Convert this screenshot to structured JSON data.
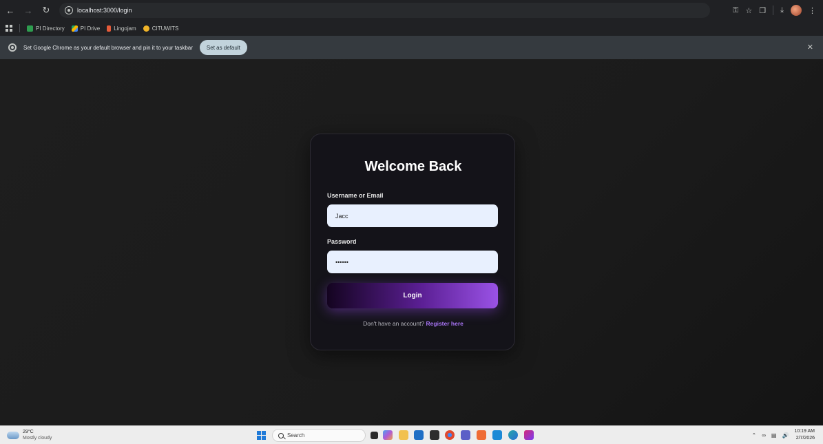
{
  "browser": {
    "url": "localhost:3000/login",
    "bookmarks": [
      {
        "label": "PI Directory",
        "color": "#2e9d4f"
      },
      {
        "label": "PI Drive",
        "color": "#f5b400"
      },
      {
        "label": "Lingojam",
        "color": "#e65b3a"
      },
      {
        "label": "CITUWITS",
        "color": "#f0b429"
      }
    ],
    "infobar": {
      "message": "Set Google Chrome as your default browser and pin it to your taskbar",
      "button_label": "Set as default"
    }
  },
  "login": {
    "title": "Welcome Back",
    "username_label": "Username or Email",
    "username_value": "Jacc",
    "password_label": "Password",
    "password_value": "••••••",
    "submit_label": "Login",
    "register_prompt": "Don't have an account?",
    "register_link": "Register here"
  },
  "taskbar": {
    "temperature": "29°C",
    "weather": "Mostly cloudy",
    "search_placeholder": "Search",
    "time": "10:19 AM",
    "date": "2/7/2026",
    "apps": [
      {
        "name": "task-view",
        "color": "#2b2b2b"
      },
      {
        "name": "copilot",
        "color": "#7b5cd6"
      },
      {
        "name": "file-explorer",
        "color": "#f2c14e"
      },
      {
        "name": "store",
        "color": "#1f6fc5"
      },
      {
        "name": "terminal",
        "color": "#2d2d2d"
      },
      {
        "name": "chrome",
        "color": "#e0492f"
      },
      {
        "name": "teams",
        "color": "#5b5fc7"
      },
      {
        "name": "postman",
        "color": "#ef6c35"
      },
      {
        "name": "vscode",
        "color": "#1c8ad6"
      },
      {
        "name": "edge",
        "color": "#26a6a8"
      },
      {
        "name": "intellij",
        "color": "#d4287a"
      }
    ]
  },
  "colors": {
    "accent": "#9a52e6",
    "link": "#a874f5",
    "card_bg": "#141319",
    "input_bg": "#e8f0fe"
  }
}
